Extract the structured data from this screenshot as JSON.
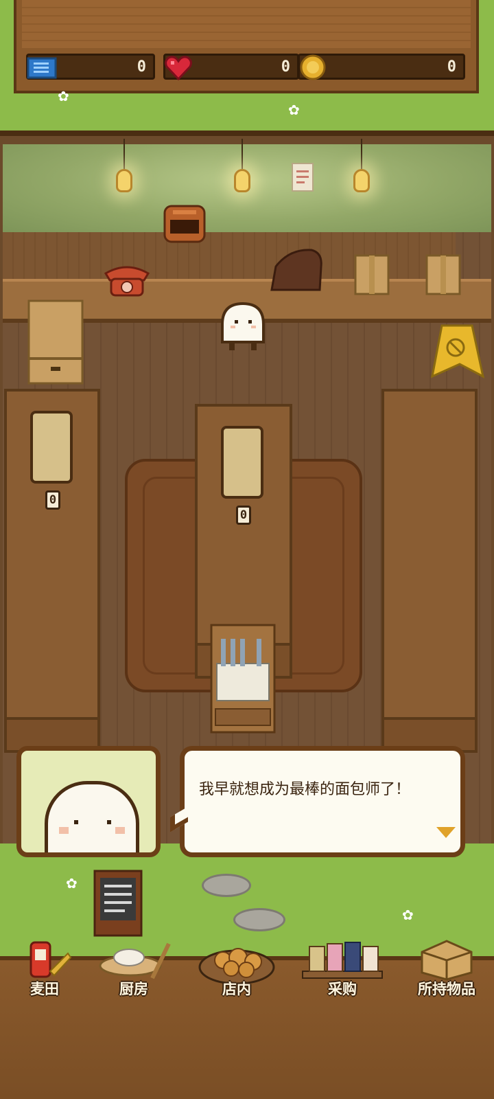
{
  "stats": {
    "tickets": "0",
    "hearts": "0",
    "coins": "0"
  },
  "trays": {
    "left_count": "0",
    "center_count": "0"
  },
  "dialog": {
    "text": "我早就想成为最棒的面包师了！"
  },
  "nav": {
    "items": [
      {
        "label": "麦田",
        "icon": "wheat-field-icon"
      },
      {
        "label": "厨房",
        "icon": "kitchen-icon"
      },
      {
        "label": "店内",
        "icon": "shop-bread-icon"
      },
      {
        "label": "采购",
        "icon": "shopping-shelf-icon"
      },
      {
        "label": "所持物品",
        "icon": "inventory-box-icon"
      }
    ]
  },
  "colors": {
    "grass": "#8dbb4a",
    "wood": "#8b5a2b",
    "dialog_bg": "#fdfbf1",
    "dialog_border": "#6b3e17",
    "accent": "#e0a22a"
  }
}
